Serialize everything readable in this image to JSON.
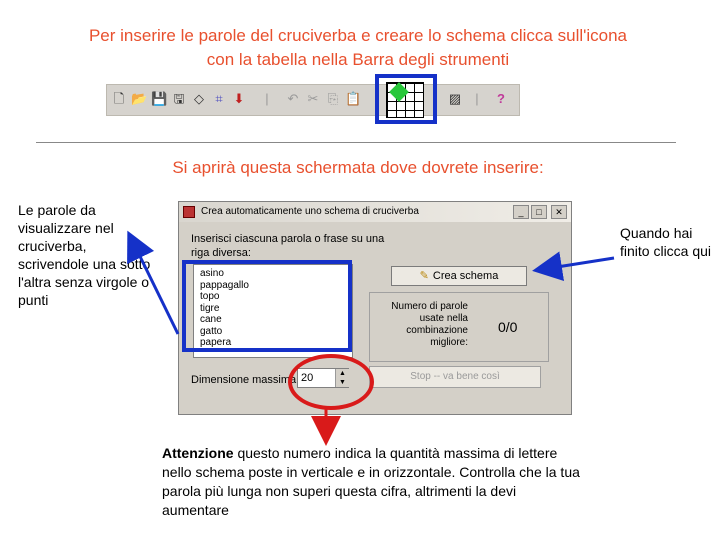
{
  "heading": {
    "line1": "Per inserire le parole del cruciverba e creare lo schema clicca sull'icona",
    "line2": "con la tabella nella Barra degli strumenti"
  },
  "toolbar": {
    "icons": [
      "new-doc-icon",
      "open-folder-icon",
      "save-icon",
      "save-all-icon",
      "eraser-icon",
      "grid-dots-icon",
      "arrow-down-icon",
      "undo-icon",
      "cut-icon",
      "copy-icon",
      "paste-icon",
      "create-grid-icon",
      "print-icon",
      "help-icon"
    ],
    "help_label": "?"
  },
  "subheading": "Si aprirà questa schermata dove dovrete inserire:",
  "left_note": "Le parole da visualizzare nel cruciverba, scrivendole una sotto l'altra senza virgole o punti",
  "right_note": "Quando hai finito clicca qui",
  "bottom_note": {
    "bold": "Attenzione",
    "text": " questo numero indica la quantità massima di lettere nello schema poste in verticale e in orizzontale. Controlla che la tua parola più lunga non superi questa cifra, altrimenti la devi aumentare"
  },
  "dialog": {
    "title": "Crea automaticamente uno schema di cruciverba",
    "instruction": "Inserisci ciascuna parola o frase su una riga diversa:",
    "words": [
      "asino",
      "pappagallo",
      "topo",
      "tigre",
      "cane",
      "gatto",
      "papera"
    ],
    "create_button": "Crea schema",
    "stats_label": "Numero di parole usate nella combinazione migliore:",
    "stats_value": "0/0",
    "dimension_label": "Dimensione massima:",
    "dimension_value": "20",
    "stop_button": "Stop -- va bene così"
  },
  "colors": {
    "accent_text": "#e8502e",
    "highlight_blue": "#1531c8",
    "circle_red": "#d91a1a"
  }
}
